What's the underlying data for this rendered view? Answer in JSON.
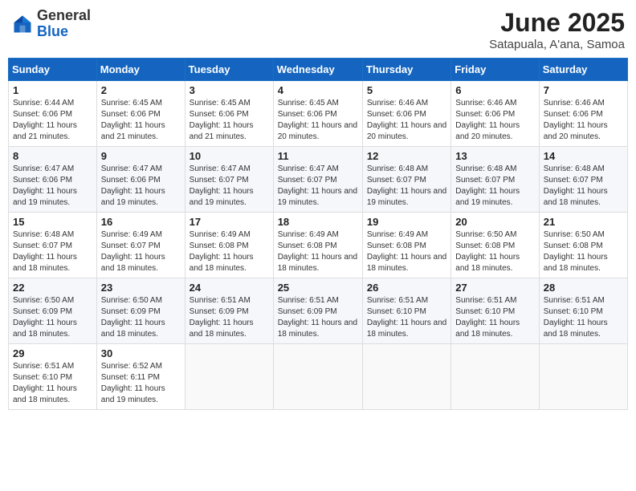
{
  "header": {
    "logo_general": "General",
    "logo_blue": "Blue",
    "title": "June 2025",
    "location": "Satapuala, A'ana, Samoa"
  },
  "days_of_week": [
    "Sunday",
    "Monday",
    "Tuesday",
    "Wednesday",
    "Thursday",
    "Friday",
    "Saturday"
  ],
  "weeks": [
    [
      {
        "day": "1",
        "sunrise": "6:44 AM",
        "sunset": "6:06 PM",
        "daylight": "11 hours and 21 minutes."
      },
      {
        "day": "2",
        "sunrise": "6:45 AM",
        "sunset": "6:06 PM",
        "daylight": "11 hours and 21 minutes."
      },
      {
        "day": "3",
        "sunrise": "6:45 AM",
        "sunset": "6:06 PM",
        "daylight": "11 hours and 21 minutes."
      },
      {
        "day": "4",
        "sunrise": "6:45 AM",
        "sunset": "6:06 PM",
        "daylight": "11 hours and 20 minutes."
      },
      {
        "day": "5",
        "sunrise": "6:46 AM",
        "sunset": "6:06 PM",
        "daylight": "11 hours and 20 minutes."
      },
      {
        "day": "6",
        "sunrise": "6:46 AM",
        "sunset": "6:06 PM",
        "daylight": "11 hours and 20 minutes."
      },
      {
        "day": "7",
        "sunrise": "6:46 AM",
        "sunset": "6:06 PM",
        "daylight": "11 hours and 20 minutes."
      }
    ],
    [
      {
        "day": "8",
        "sunrise": "6:47 AM",
        "sunset": "6:06 PM",
        "daylight": "11 hours and 19 minutes."
      },
      {
        "day": "9",
        "sunrise": "6:47 AM",
        "sunset": "6:06 PM",
        "daylight": "11 hours and 19 minutes."
      },
      {
        "day": "10",
        "sunrise": "6:47 AM",
        "sunset": "6:07 PM",
        "daylight": "11 hours and 19 minutes."
      },
      {
        "day": "11",
        "sunrise": "6:47 AM",
        "sunset": "6:07 PM",
        "daylight": "11 hours and 19 minutes."
      },
      {
        "day": "12",
        "sunrise": "6:48 AM",
        "sunset": "6:07 PM",
        "daylight": "11 hours and 19 minutes."
      },
      {
        "day": "13",
        "sunrise": "6:48 AM",
        "sunset": "6:07 PM",
        "daylight": "11 hours and 19 minutes."
      },
      {
        "day": "14",
        "sunrise": "6:48 AM",
        "sunset": "6:07 PM",
        "daylight": "11 hours and 18 minutes."
      }
    ],
    [
      {
        "day": "15",
        "sunrise": "6:48 AM",
        "sunset": "6:07 PM",
        "daylight": "11 hours and 18 minutes."
      },
      {
        "day": "16",
        "sunrise": "6:49 AM",
        "sunset": "6:07 PM",
        "daylight": "11 hours and 18 minutes."
      },
      {
        "day": "17",
        "sunrise": "6:49 AM",
        "sunset": "6:08 PM",
        "daylight": "11 hours and 18 minutes."
      },
      {
        "day": "18",
        "sunrise": "6:49 AM",
        "sunset": "6:08 PM",
        "daylight": "11 hours and 18 minutes."
      },
      {
        "day": "19",
        "sunrise": "6:49 AM",
        "sunset": "6:08 PM",
        "daylight": "11 hours and 18 minutes."
      },
      {
        "day": "20",
        "sunrise": "6:50 AM",
        "sunset": "6:08 PM",
        "daylight": "11 hours and 18 minutes."
      },
      {
        "day": "21",
        "sunrise": "6:50 AM",
        "sunset": "6:08 PM",
        "daylight": "11 hours and 18 minutes."
      }
    ],
    [
      {
        "day": "22",
        "sunrise": "6:50 AM",
        "sunset": "6:09 PM",
        "daylight": "11 hours and 18 minutes."
      },
      {
        "day": "23",
        "sunrise": "6:50 AM",
        "sunset": "6:09 PM",
        "daylight": "11 hours and 18 minutes."
      },
      {
        "day": "24",
        "sunrise": "6:51 AM",
        "sunset": "6:09 PM",
        "daylight": "11 hours and 18 minutes."
      },
      {
        "day": "25",
        "sunrise": "6:51 AM",
        "sunset": "6:09 PM",
        "daylight": "11 hours and 18 minutes."
      },
      {
        "day": "26",
        "sunrise": "6:51 AM",
        "sunset": "6:10 PM",
        "daylight": "11 hours and 18 minutes."
      },
      {
        "day": "27",
        "sunrise": "6:51 AM",
        "sunset": "6:10 PM",
        "daylight": "11 hours and 18 minutes."
      },
      {
        "day": "28",
        "sunrise": "6:51 AM",
        "sunset": "6:10 PM",
        "daylight": "11 hours and 18 minutes."
      }
    ],
    [
      {
        "day": "29",
        "sunrise": "6:51 AM",
        "sunset": "6:10 PM",
        "daylight": "11 hours and 18 minutes."
      },
      {
        "day": "30",
        "sunrise": "6:52 AM",
        "sunset": "6:11 PM",
        "daylight": "11 hours and 19 minutes."
      },
      null,
      null,
      null,
      null,
      null
    ]
  ]
}
